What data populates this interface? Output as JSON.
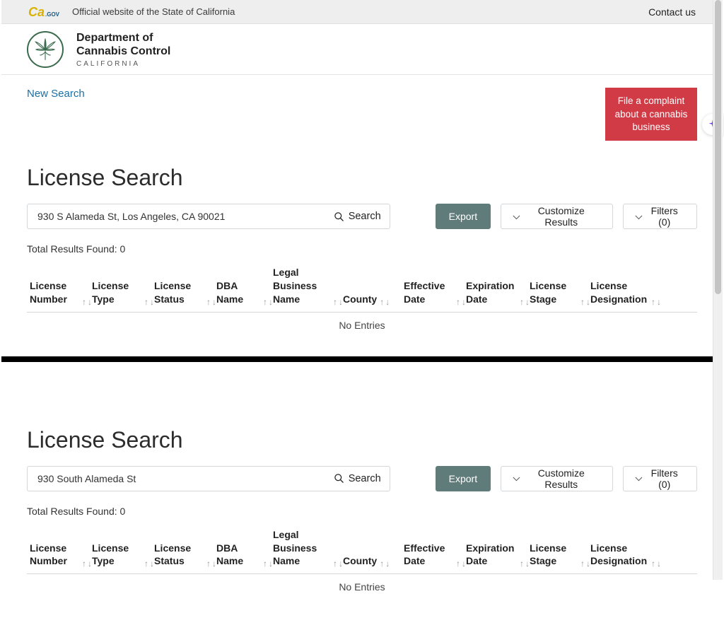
{
  "govbar": {
    "logo_gov": ".GOV",
    "tagline": "Official website of the State of California",
    "contact": "Contact us"
  },
  "dept": {
    "line1": "Department of",
    "line2": "Cannabis Control",
    "sub": "CALIFORNIA"
  },
  "top": {
    "new_search": "New Search",
    "complaint": "File a complaint about a cannabis business"
  },
  "page_title": "License Search",
  "search_label": "Search",
  "export_label": "Export",
  "customize_label": "Customize Results",
  "filters_label": "Filters (0)",
  "total_prefix": "Total Results Found: ",
  "no_entries": "No Entries",
  "columns": [
    "License Number",
    "License Type",
    "License Status",
    "DBA Name",
    "Legal Business Name",
    "County",
    "Effective Date",
    "Expiration Date",
    "License Stage",
    "License Designation"
  ],
  "frame1": {
    "query": "930 S Alameda St, Los Angeles, CA 90021",
    "total": 0
  },
  "frame2": {
    "query": "930 South Alameda St",
    "total": 0
  }
}
